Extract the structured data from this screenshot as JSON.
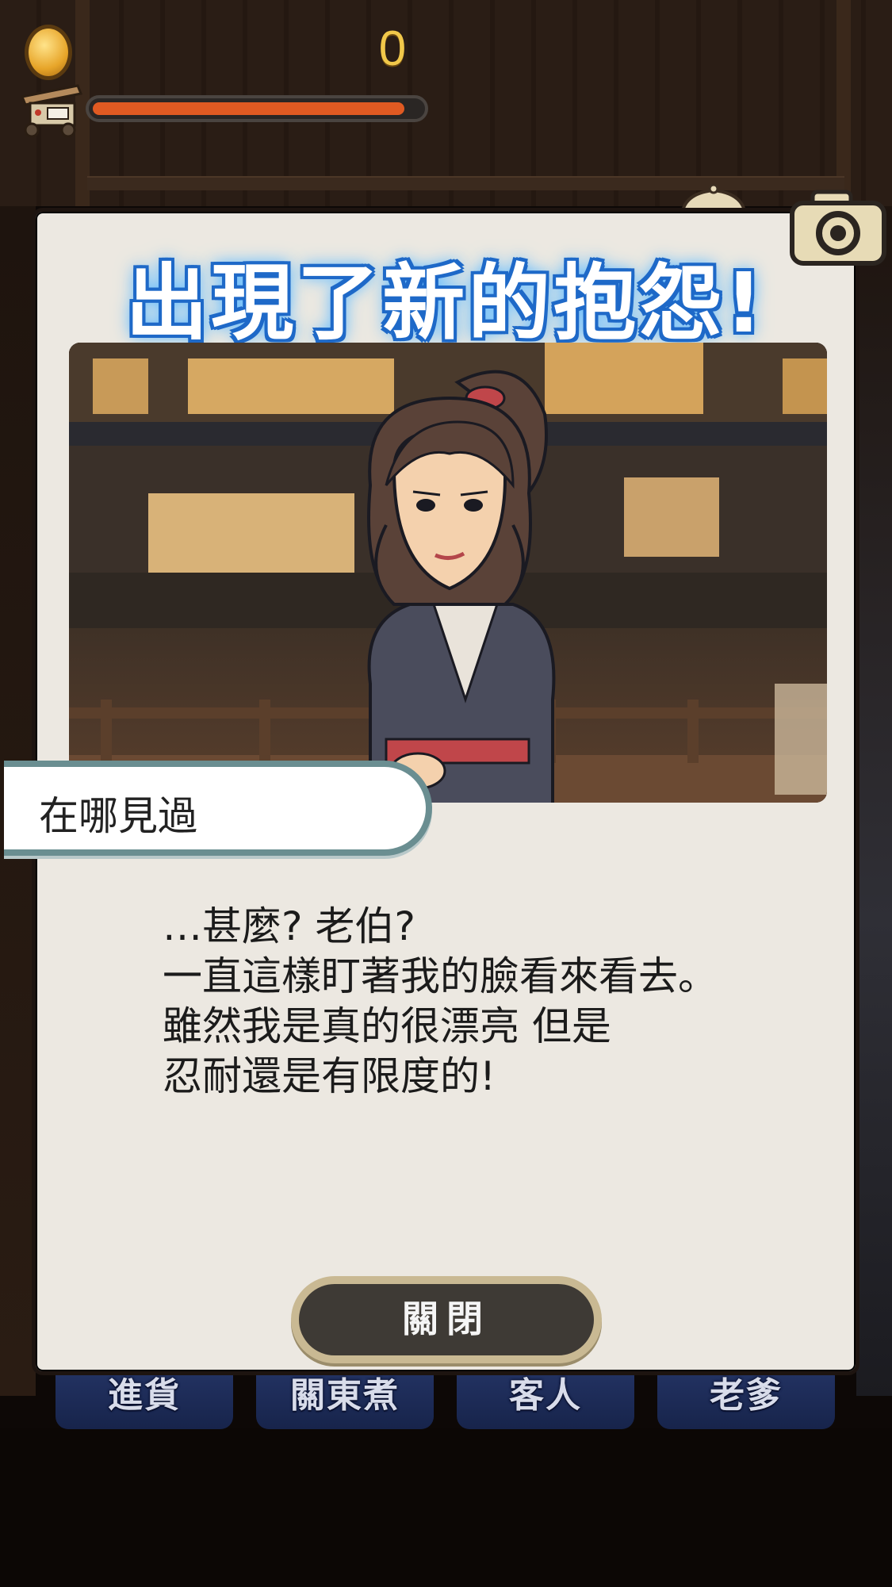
{
  "hud": {
    "coin_count": "0",
    "progress_fraction": 0.95,
    "progress_color": "#e05a22"
  },
  "dialog": {
    "title": "出現了新的抱怨!",
    "character_name": "在哪見過",
    "message_lines": [
      "…甚麼? 老伯?",
      "一直這樣盯著我的臉看來看去。",
      "雖然我是真的很漂亮 但是",
      "忍耐還是有限度的!"
    ],
    "close_label": "關閉"
  },
  "tabs": [
    {
      "label": "進貨"
    },
    {
      "label": "關東煮"
    },
    {
      "label": "客人"
    },
    {
      "label": "老爹"
    }
  ],
  "icons": {
    "coin": "coin-icon",
    "cart": "oden-cart-icon",
    "camera": "camera-icon",
    "bell": "bell-icon"
  }
}
